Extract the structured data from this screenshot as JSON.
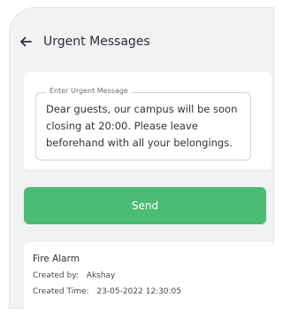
{
  "header": {
    "title": "Urgent Messages",
    "back_icon": "arrow-left-icon"
  },
  "form": {
    "field_label": "Enter Urgent Message",
    "field_value": "Dear guests, our campus will be soon closing at 20:00. Please leave beforehand with all your belongings.",
    "send_label": "Send",
    "send_color": "#4cbb73"
  },
  "message": {
    "title": "Fire Alarm",
    "created_by_label": "Created by:",
    "created_by_value": "Akshay",
    "created_time_label": "Created Time:",
    "created_time_value": "23-05-2022 12:30:05"
  }
}
